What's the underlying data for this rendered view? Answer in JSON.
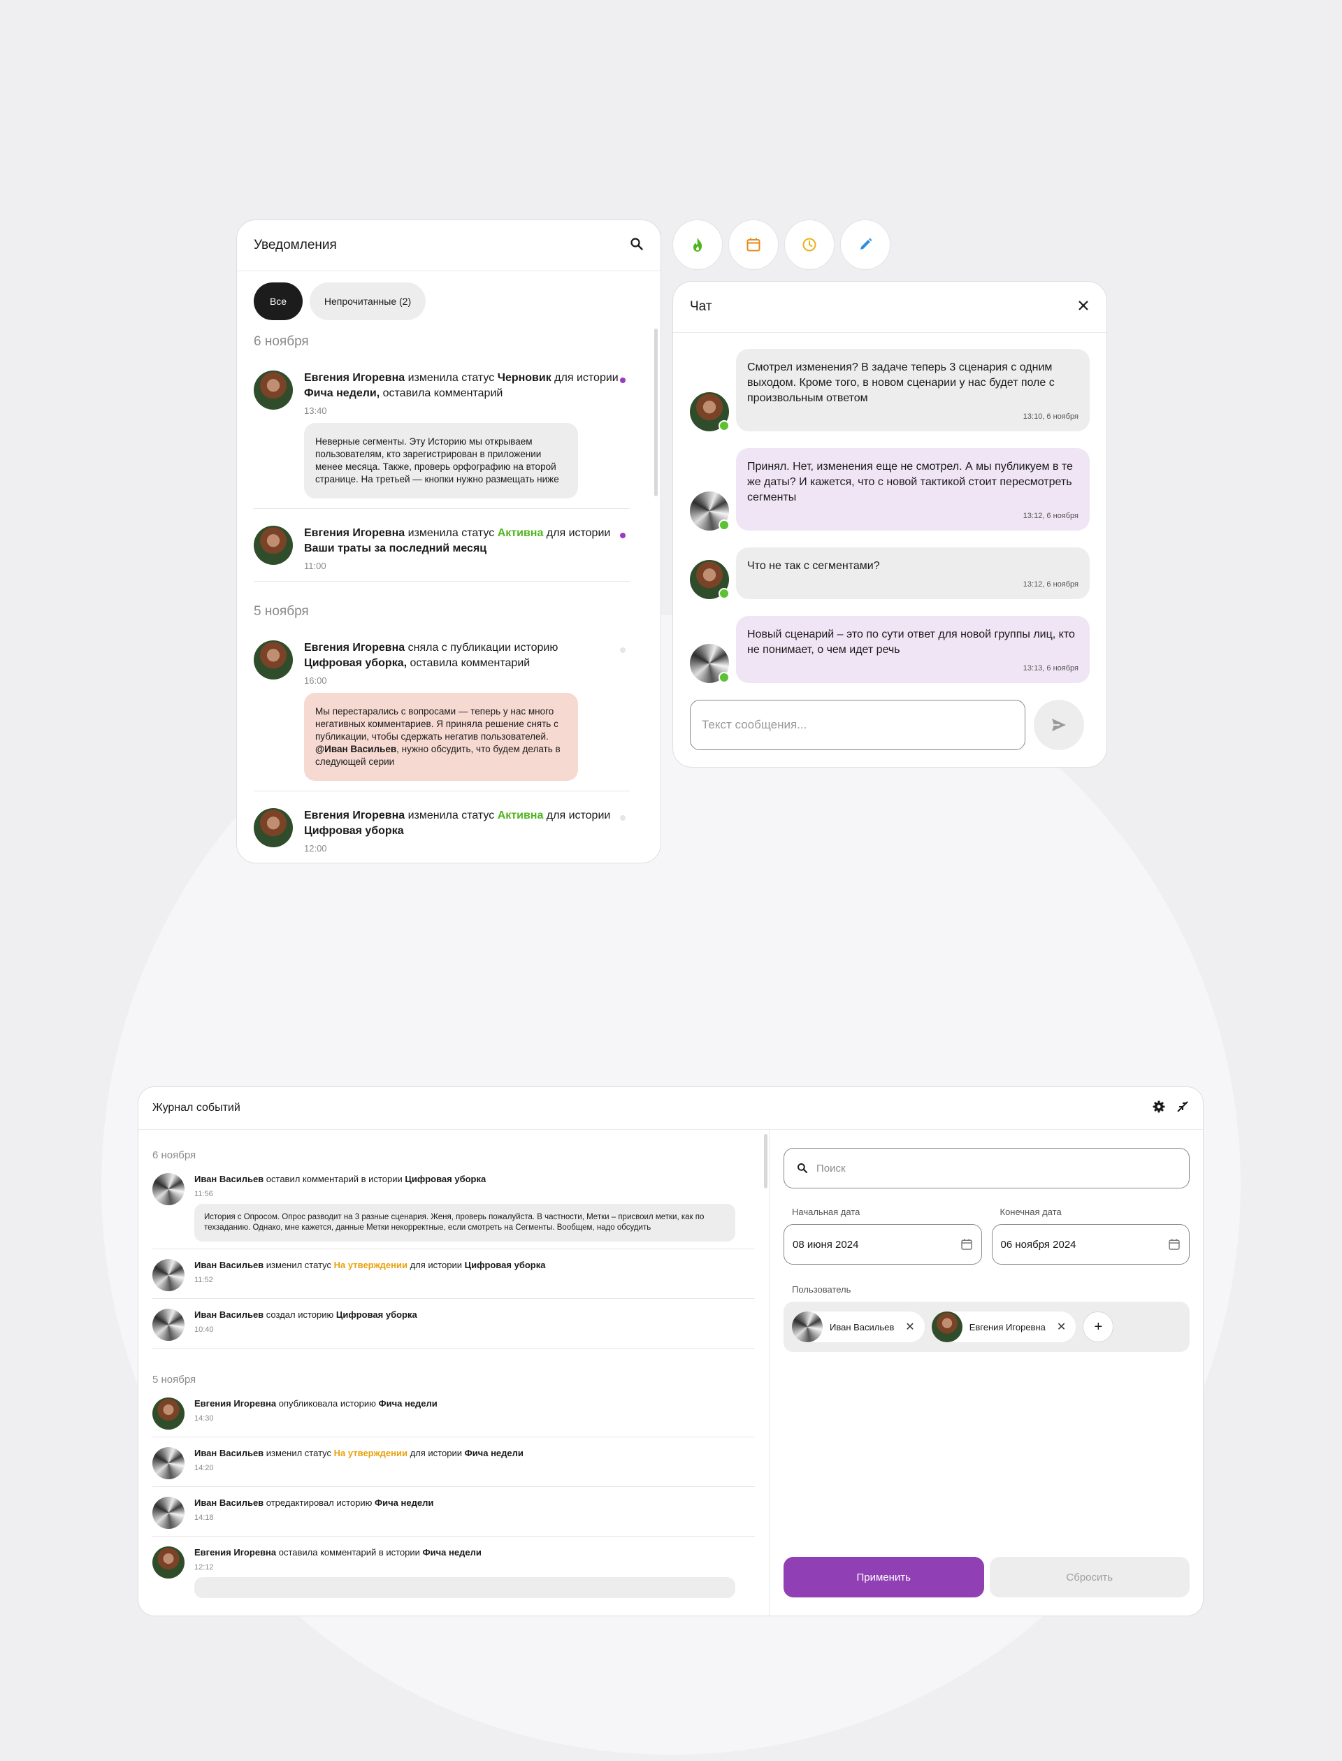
{
  "colors": {
    "accent": "#9040b4",
    "active_status": "#4fb51d",
    "pending_status": "#e8a10a",
    "unread_dot": "#9b3bbf",
    "online": "#5cc234"
  },
  "notifications": {
    "title": "Уведомления",
    "tabs": [
      {
        "label": "Все"
      },
      {
        "label": "Непрочитанные (2)"
      }
    ],
    "groups": [
      {
        "date": "6 ноября",
        "items": [
          {
            "user": "Евгения Игоревна",
            "action": " изменила статус ",
            "status": "Черновик",
            "after_status": " для истории ",
            "story": "Фича недели,",
            "suffix": " оставила комментарий",
            "time": "13:40",
            "comment": "Неверные сегменты. Эту Историю мы открываем пользователям, кто зарегистрирован в приложении менее месяца. Также, проверь орфографию на второй странице. На третьей — кнопки нужно размещать ниже",
            "unread": true
          },
          {
            "user": "Евгения Игоревна",
            "action": " изменила статус ",
            "status": "Активна",
            "after_status": " для истории ",
            "story": "Ваши траты за последний месяц",
            "time": "11:00",
            "unread": true
          }
        ]
      },
      {
        "date": "5 ноября",
        "items": [
          {
            "user": "Евгения Игоревна",
            "action": " сняла с публикации историю ",
            "story": "Цифровая уборка,",
            "suffix": " оставила комментарий",
            "time": "16:00",
            "comment_before": "Мы перестарались с вопросами — теперь у нас много негативных комментариев. Я приняла решение снять с публикации, чтобы сдержать негатив пользователей. ",
            "mention": "@Иван Васильев",
            "comment_after": ", нужно обсудить, что будем делать в следующей серии",
            "unread": false
          },
          {
            "user": "Евгения Игоревна",
            "action": " изменила статус ",
            "status": "Активна",
            "after_status": " для истории ",
            "story": "Цифровая уборка",
            "time": "12:00",
            "unread": false
          }
        ]
      }
    ]
  },
  "toolbar": {
    "icons": [
      "fire-icon",
      "calendar-icon",
      "clock-icon",
      "pencil-icon"
    ]
  },
  "chat": {
    "title": "Чат",
    "messages": [
      {
        "text": "Смотрел изменения? В задаче теперь 3 сценария с одним выходом. Кроме того, в новом сценарии у нас будет поле с произвольным ответом",
        "time": "13:10, 6 ноября",
        "mine": false
      },
      {
        "text": "Принял. Нет, изменения еще не смотрел. А мы публикуем в те же даты? И кажется, что с новой тактикой стоит пересмотреть сегменты",
        "time": "13:12, 6 ноября",
        "mine": true
      },
      {
        "text": "Что не так с сегментами?",
        "time": "13:12, 6 ноября",
        "mine": false
      },
      {
        "text": "Новый сценарий – это по сути ответ для новой группы лиц, кто не понимает, о чем идет речь",
        "time": "13:13, 6 ноября",
        "mine": true
      }
    ],
    "input_placeholder": "Текст сообщения..."
  },
  "event_log": {
    "title": "Журнал событий",
    "groups": [
      {
        "date": "6 ноября",
        "items": [
          {
            "user": "Иван Васильев",
            "action": " оставил комментарий в истории ",
            "story": "Цифровая уборка",
            "time": "11:56",
            "comment": "История с Опросом. Опрос разводит на 3 разные сценария. Женя, проверь пожалуйста. В частности, Метки – присвоил метки, как по техзаданию. Однако, мне кажется, данные Метки некорректные, если смотреть на Сегменты. Вообщем, надо обсудить"
          },
          {
            "user": "Иван Васильев",
            "action": " изменил статус ",
            "status": "На утверждении",
            "after_status": " для истории ",
            "story": "Цифровая уборка",
            "time": "11:52"
          },
          {
            "user": "Иван Васильев",
            "action": " создал историю ",
            "story": "Цифровая уборка",
            "time": "10:40"
          }
        ]
      },
      {
        "date": "5 ноября",
        "items": [
          {
            "user": "Евгения Игоревна",
            "action": " опубликовала историю ",
            "story": "Фича недели",
            "time": "14:30"
          },
          {
            "user": "Иван Васильев",
            "action": " изменил статус ",
            "status": "На утверждении",
            "after_status": " для истории ",
            "story": "Фича недели",
            "time": "14:20"
          },
          {
            "user": "Иван Васильев",
            "action": " отредактировал историю ",
            "story": "Фича недели",
            "time": "14:18"
          },
          {
            "user": "Евгения Игоревна",
            "action": " оставила комментарий в истории ",
            "story": "Фича недели",
            "time": "12:12"
          }
        ]
      }
    ],
    "filters": {
      "search_placeholder": "Поиск",
      "start_label": "Начальная дата",
      "start_value": "08 июня 2024",
      "end_label": "Конечная дата",
      "end_value": "06 ноября 2024",
      "user_label": "Пользователь",
      "users": [
        "Иван Васильев",
        "Евгения Игоревна"
      ],
      "apply_label": "Применить",
      "reset_label": "Сбросить"
    }
  }
}
